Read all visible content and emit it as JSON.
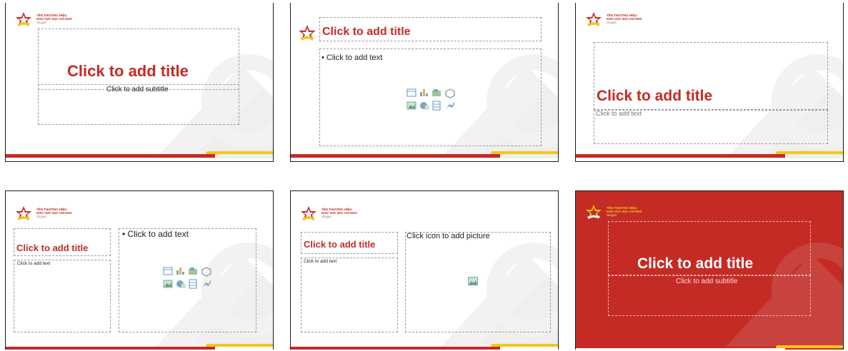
{
  "logo": {
    "line1": "TÊN THƯƠNG HIỆU",
    "line2": "KHU VỰC ĐỊA CHỈ NHÀ",
    "line3": "Slogan"
  },
  "slides": [
    {
      "title": "Click to add title",
      "subtitle": "Click to add subtitle"
    },
    {
      "title": "Click to add title",
      "body": "• Click to add text"
    },
    {
      "title": "Click to add title",
      "body": "Click to add text"
    },
    {
      "title": "Click to add title",
      "body": "Click to add text",
      "content": "• Click to add text"
    },
    {
      "title": "Click to add title",
      "body": "Click to add text",
      "picture": "Click icon to add picture"
    },
    {
      "title": "Click to add title",
      "subtitle": "Click to add subtitle"
    }
  ],
  "colors": {
    "brand_red": "#c42b25",
    "brand_yellow": "#f5c518"
  },
  "icons": [
    "table-icon",
    "chart-icon",
    "smartart-icon",
    "3d-model-icon",
    "picture-icon",
    "online-picture-icon",
    "video-icon",
    "icon-insert-icon"
  ]
}
